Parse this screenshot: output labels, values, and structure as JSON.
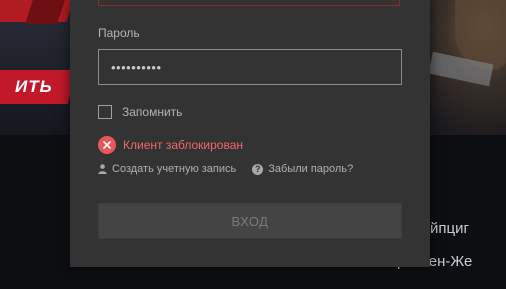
{
  "background": {
    "banner_text": "ИТЬ",
    "right_text_1": "йпциг",
    "right_text_2": "ри Сен-Же"
  },
  "login_form": {
    "password_label": "Пароль",
    "password_value": "••••••••••",
    "remember_label": "Запомнить",
    "remember_checked": false,
    "error_message": "Клиент заблокирован",
    "create_account_link": "Создать учетную запись",
    "forgot_password_link": "Забыли пароль?",
    "submit_label": "ВХОД"
  },
  "icons": {
    "error": "close-circle-icon",
    "create_account": "user-icon",
    "forgot_password": "question-circle-icon"
  },
  "colors": {
    "modal_bg": "#333333",
    "error": "#f06767",
    "error_icon": "#e8575a",
    "banner": "#c2192a"
  }
}
